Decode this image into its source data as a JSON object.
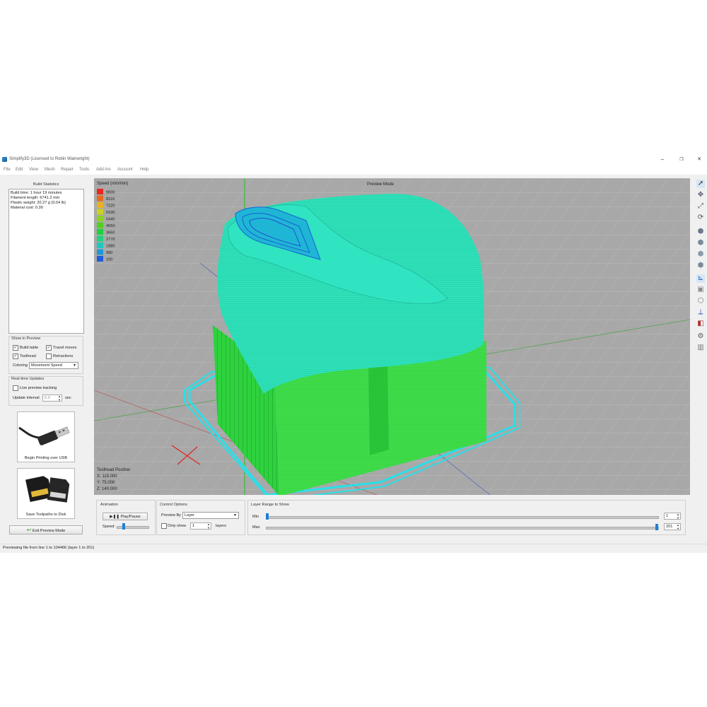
{
  "window": {
    "title": "Simplify3D (Licensed to Robin Wainwright)",
    "minimize": "–",
    "maximize": "❐",
    "close": "✕"
  },
  "menu": [
    "File",
    "Edit",
    "View",
    "Mesh",
    "Repair",
    "Tools",
    "Add-Ins",
    "Account",
    "Help"
  ],
  "build_statistics": {
    "title": "Build Statistics",
    "lines": [
      "Build time: 1 hour 19 minutes",
      "Filament length: 6741.2 mm",
      "Plastic weight: 20.27 g (0.04 lb)",
      "Material cost: 0.39"
    ]
  },
  "show_in_preview": {
    "title": "Show in Preview",
    "build_table": "Build table",
    "travel_moves": "Travel moves",
    "toolhead": "Toolhead",
    "retractions": "Retractions",
    "coloring_label": "Coloring",
    "coloring_value": "Movement Speed"
  },
  "realtime": {
    "title": "Real-time Updates",
    "live_tracking": "Live preview tracking",
    "interval_label": "Update interval",
    "interval_value": "5.0",
    "interval_unit": "sec"
  },
  "actions": {
    "usb_label": "Begin Printing over USB",
    "disk_label": "Save Toolpaths to Disk",
    "exit_label": "Exit Preview Mode"
  },
  "viewport": {
    "mode_label": "Preview Mode",
    "legend_title": "Speed (mm/min)",
    "legend": [
      {
        "value": "9000",
        "color": "#e8281e"
      },
      {
        "value": "8110",
        "color": "#e86a1e"
      },
      {
        "value": "7220",
        "color": "#e8b21e"
      },
      {
        "value": "6330",
        "color": "#c8d21e"
      },
      {
        "value": "5440",
        "color": "#8cd21e"
      },
      {
        "value": "4550",
        "color": "#4ed21e"
      },
      {
        "value": "3660",
        "color": "#1ed23a"
      },
      {
        "value": "2770",
        "color": "#1ed27e"
      },
      {
        "value": "1880",
        "color": "#1ec8c0"
      },
      {
        "value": "990",
        "color": "#1e9ad8"
      },
      {
        "value": "100",
        "color": "#1e5ed8"
      }
    ],
    "toolhead_title": "Toolhead Position",
    "toolhead_x": "X: 115.000",
    "toolhead_y": "Y: 75.000",
    "toolhead_z": "Z: 140.000"
  },
  "animation": {
    "title": "Animation",
    "play": "Play/Pause",
    "speed_label": "Speed:"
  },
  "control": {
    "title": "Control Options",
    "preview_by_label": "Preview By",
    "preview_by_value": "Layer",
    "only_show": "Only show",
    "only_show_value": "1",
    "layers": "layers"
  },
  "layer_range": {
    "title": "Layer Range to Show",
    "min_label": "Min",
    "max_label": "Max",
    "min_value": "1",
    "max_value": "201"
  },
  "status": "Previewing file from line 1 to 104466 (layer 1 to 201)"
}
